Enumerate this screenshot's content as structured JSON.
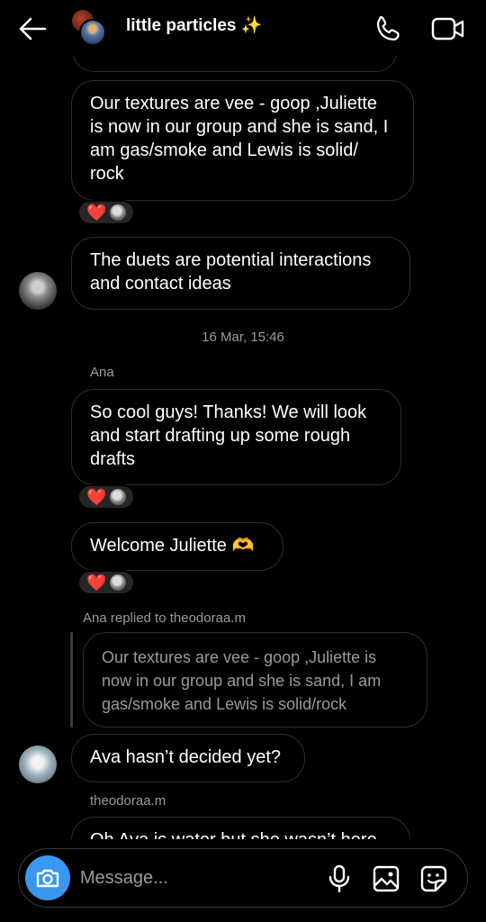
{
  "header": {
    "back_icon": "arrow-left-icon",
    "title": "little particles ✨",
    "call_icon": "phone-icon",
    "video_icon": "video-camera-icon"
  },
  "messages": [
    {
      "text": "Our textures are vee - goop ,Juliette is now in our group and she is sand, I am gas/smoke and Lewis is solid/ rock",
      "reactions": [
        "❤️"
      ]
    },
    {
      "text": "The duets are potential interactions and contact ideas"
    },
    {
      "timestamp": "16 Mar, 15:46"
    },
    {
      "sender": "Ana"
    },
    {
      "text": "So cool guys! Thanks! We will look and start drafting up some rough drafts",
      "reactions": [
        "❤️"
      ]
    },
    {
      "text": "Welcome Juliette 🫶",
      "reactions": [
        "❤️"
      ]
    },
    {
      "reply_label": "Ana replied to theodoraa.m",
      "reply_text": "Our textures are vee - goop ,Juliette is now in our group and she is sand, I am gas/smoke and Lewis is solid/rock"
    },
    {
      "text": "Ava hasn’t decided yet?"
    },
    {
      "sender": "theodoraa.m"
    },
    {
      "text": "Oh Ava is water but she wasn’t here"
    }
  ],
  "composer": {
    "placeholder": "Message...",
    "camera_icon": "camera-icon",
    "mic_icon": "microphone-icon",
    "gallery_icon": "image-gallery-icon",
    "sticker_icon": "sticker-icon"
  },
  "colors": {
    "accent": "#3897f0",
    "bubble_border": "#2e2e2e",
    "reaction_bg": "#262626",
    "muted_text": "#9a9a9a",
    "heart": "#ff2d3d"
  }
}
